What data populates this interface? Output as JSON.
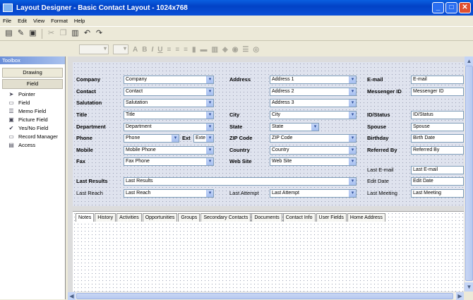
{
  "window": {
    "title": "Layout Designer - Basic Contact Layout - 1024x768"
  },
  "menu": [
    "File",
    "Edit",
    "View",
    "Format",
    "Help"
  ],
  "toolbox": {
    "header": "Toolbox",
    "sections": [
      "Drawing",
      "Field"
    ],
    "items": [
      {
        "label": "Pointer",
        "icon": "pointer-icon",
        "glyph": "➤"
      },
      {
        "label": "Field",
        "icon": "field-icon",
        "glyph": "▭"
      },
      {
        "label": "Memo Field",
        "icon": "memo-field-icon",
        "glyph": "☰"
      },
      {
        "label": "Picture Field",
        "icon": "picture-field-icon",
        "glyph": "▣"
      },
      {
        "label": "Yes/No Field",
        "icon": "checkbox-icon",
        "glyph": "✔"
      },
      {
        "label": "Record Manager",
        "icon": "record-manager-icon",
        "glyph": "▭"
      },
      {
        "label": "Access",
        "icon": "access-icon",
        "glyph": "▤"
      }
    ]
  },
  "form": {
    "company_label": "Company",
    "company_value": "Company",
    "contact_label": "Contact",
    "contact_value": "Contact",
    "salutation_label": "Salutation",
    "salutation_value": "Salutation",
    "title_label": "Title",
    "title_value": "Title",
    "department_label": "Department",
    "department_value": "Department",
    "phone_label": "Phone",
    "phone_value": "Phone",
    "ext_label": "Ext",
    "ext_value": "Exte",
    "mobile_label": "Mobile",
    "mobile_value": "Mobile Phone",
    "fax_label": "Fax",
    "fax_value": "Fax Phone",
    "address_label": "Address",
    "address1": "Address 1",
    "address2": "Address 2",
    "address3": "Address 3",
    "city_label": "City",
    "city_value": "City",
    "state_label": "State",
    "state_value": "State",
    "zip_label": "ZIP Code",
    "zip_value": "ZIP Code",
    "country_label": "Country",
    "country_value": "Country",
    "website_label": "Web Site",
    "website_value": "Web Site",
    "email_label": "E-mail",
    "email_value": "E-mail",
    "messenger_label": "Messenger ID",
    "messenger_value": "Messenger ID",
    "idstatus_label": "ID/Status",
    "idstatus_value": "ID/Status",
    "spouse_label": "Spouse",
    "spouse_value": "Spouse",
    "birthday_label": "Birthday",
    "birthday_value": "Birth Date",
    "referred_label": "Referred By",
    "referred_value": "Referred By",
    "last_email_label": "Last E-mail",
    "last_email_value": "Last E-mail",
    "edit_date_label": "Edit Date",
    "edit_date_value": "Edit Date",
    "last_results_label": "Last Results",
    "last_results_value": "Last Results",
    "last_reach_label": "Last Reach",
    "last_reach_value": "Last Reach",
    "last_attempt_label": "Last Attempt",
    "last_attempt_value": "Last Attempt",
    "last_meeting_label": "Last Meeting",
    "last_meeting_value": "Last Meeting"
  },
  "tabs": [
    "Notes",
    "History",
    "Activities",
    "Opportunities",
    "Groups",
    "Secondary Contacts",
    "Documents",
    "Contact Info",
    "User Fields",
    "Home Address"
  ]
}
